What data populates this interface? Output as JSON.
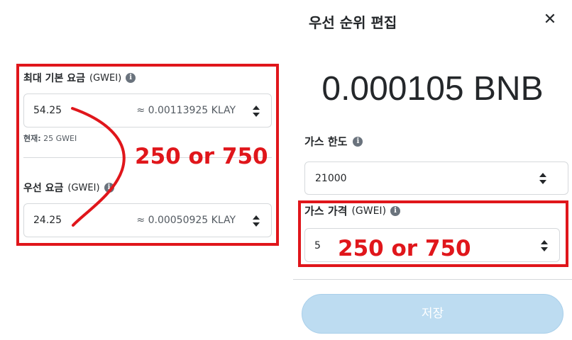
{
  "left_panel": {
    "max_base_fee": {
      "label": "최대 기본 요금",
      "unit": "(GWEI)",
      "value": "54.25",
      "conversion": "≈ 0.00113925 KLAY"
    },
    "current_note": {
      "prefix": "현재:",
      "value": "25 GWEI"
    },
    "priority_fee": {
      "label": "우선 요금",
      "unit": "(GWEI)",
      "value": "24.25",
      "conversion": "≈ 0.00050925 KLAY"
    },
    "annotation": "250 or 750"
  },
  "right_panel": {
    "title": "우선 순위 편집",
    "close_symbol": "✕",
    "amount": "0.000105 BNB",
    "gas_limit": {
      "label": "가스 한도",
      "value": "21000"
    },
    "gas_price": {
      "label": "가스 가격",
      "unit": "(GWEI)",
      "value": "5"
    },
    "annotation": "250 or 750",
    "save_label": "저장"
  },
  "colors": {
    "annotation_red": "#e0161b",
    "save_button_bg": "#bddcf1",
    "text": "#24272a",
    "border": "#d6d9dc"
  },
  "icons": {
    "info": "info-icon",
    "close": "close-icon",
    "stepper": "stepper-arrows-icon"
  }
}
